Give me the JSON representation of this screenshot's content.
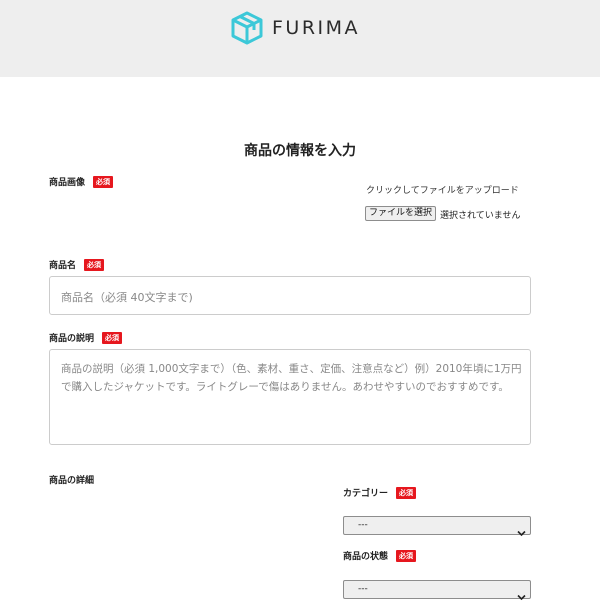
{
  "header": {
    "logo_text": "FURIMA",
    "logo_icon": "box-icon",
    "accent": "#3cc8d8"
  },
  "form": {
    "title": "商品の情報を入力",
    "required_badge": "必須",
    "image": {
      "label": "商品画像",
      "upload_hint": "クリックしてファイルをアップロード",
      "file_button": "ファイルを選択",
      "file_status": "選択されていません"
    },
    "name": {
      "label": "商品名",
      "placeholder": "商品名（必須 40文字まで)"
    },
    "description": {
      "label": "商品の説明",
      "placeholder": "商品の説明（必須 1,000文字まで）（色、素材、重さ、定価、注意点など）例）2010年頃に1万円で購入したジャケットです。ライトグレーで傷はありません。あわせやすいのでおすすめです。"
    },
    "details": {
      "heading": "商品の詳細",
      "category": {
        "label": "カテゴリー",
        "value": "---"
      },
      "condition": {
        "label": "商品の状態",
        "value": "---"
      }
    }
  },
  "colors": {
    "badge": "#e6171e",
    "header_bg": "#eeeeee"
  }
}
